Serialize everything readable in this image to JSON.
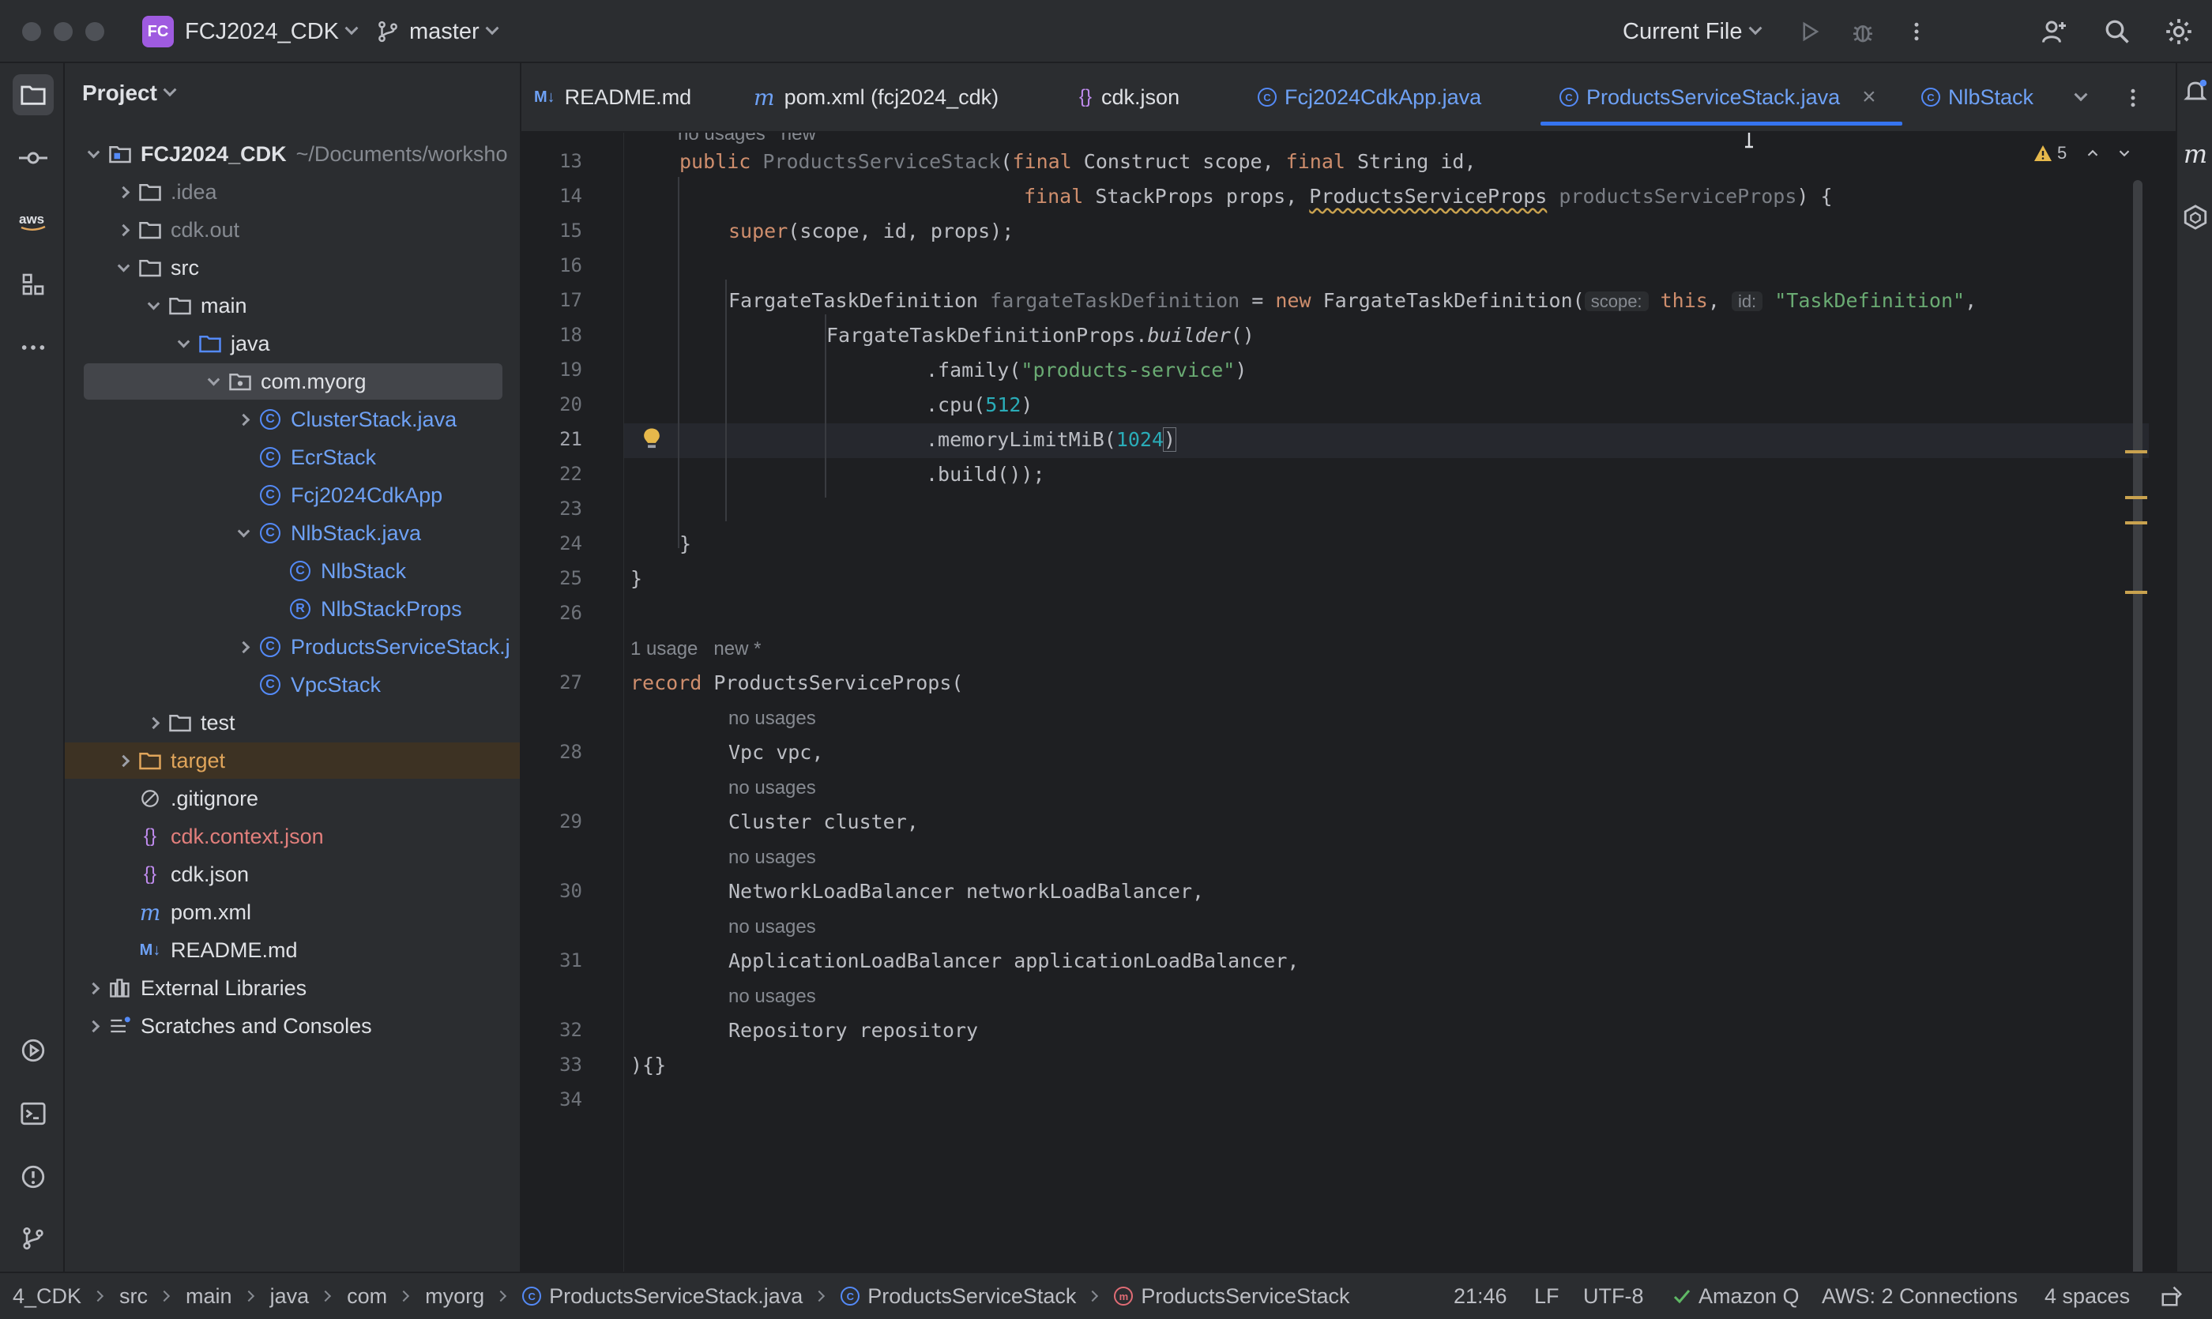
{
  "titlebar": {
    "project_badge": "FC",
    "project_name": "FCJ2024_CDK",
    "branch": "master",
    "run_config": "Current File"
  },
  "project_panel": {
    "title": "Project",
    "root_name": "FCJ2024_CDK",
    "root_path": "~/Documents/worksho",
    "items": [
      {
        "label": ".idea"
      },
      {
        "label": "cdk.out"
      },
      {
        "label": "src"
      },
      {
        "label": "main"
      },
      {
        "label": "java"
      },
      {
        "label": "com.myorg"
      },
      {
        "label": "ClusterStack.java"
      },
      {
        "label": "EcrStack"
      },
      {
        "label": "Fcj2024CdkApp"
      },
      {
        "label": "NlbStack.java"
      },
      {
        "label": "NlbStack"
      },
      {
        "label": "NlbStackProps"
      },
      {
        "label": "ProductsServiceStack.j"
      },
      {
        "label": "VpcStack"
      },
      {
        "label": "test"
      },
      {
        "label": "target"
      },
      {
        "label": ".gitignore"
      },
      {
        "label": "cdk.context.json"
      },
      {
        "label": "cdk.json"
      },
      {
        "label": "pom.xml"
      },
      {
        "label": "README.md"
      },
      {
        "label": "External Libraries"
      },
      {
        "label": "Scratches and Consoles"
      }
    ]
  },
  "tabs": [
    {
      "icon": "M↓",
      "label": "README.md"
    },
    {
      "icon": "m",
      "label": "pom.xml (fcj2024_cdk)"
    },
    {
      "icon": "{}",
      "label": "cdk.json"
    },
    {
      "icon": "C",
      "label": "Fcj2024CdkApp.java"
    },
    {
      "icon": "C",
      "label": "ProductsServiceStack.java"
    },
    {
      "icon": "C",
      "label": "NlbStack"
    }
  ],
  "editor": {
    "warning_count": "5",
    "top_hint": "no usages   new",
    "line_numbers": [
      "13",
      "14",
      "15",
      "16",
      "17",
      "18",
      "19",
      "20",
      "21",
      "22",
      "23",
      "24",
      "25",
      "26",
      "27",
      "28",
      "29",
      "30",
      "31",
      "32",
      "33",
      "34"
    ],
    "hints": {
      "record_usage": "1 usage",
      "record_new": "new *",
      "no_usages": "no usages"
    },
    "inlays": {
      "scope": "scope:",
      "id": "id:"
    },
    "tokens": {
      "public": "public",
      "ctor_name": "ProductsServiceStack",
      "final": "final",
      "construct_scope": "Construct scope, ",
      "string_id": "String id,",
      "stackprops": "StackProps props, ",
      "psp_type": "ProductsServiceProps",
      "psp_param": " productsServiceProps",
      "brace_open": ") {",
      "super_kw": "super",
      "super_args": "(scope, id, props);",
      "ftd_type": "FargateTaskDefinition ",
      "ftd_var": "fargateTaskDefinition",
      "eq": " = ",
      "new_kw": "new",
      "ftd_ctor": " FargateTaskDefinition(",
      "this_kw": "this",
      "comma": ", ",
      "task_def_str": "\"TaskDefinition\"",
      "trail_comma": ",",
      "builder_line": "FargateTaskDefinitionProps.",
      "builder_call": "builder",
      "parens": "()",
      "family_call": ".family(",
      "family_str": "\"products-service\"",
      "close_paren": ")",
      "cpu_call": ".cpu(",
      "cpu_val": "512",
      "mem_call": ".memoryLimitMiB(",
      "mem_val": "1024",
      "build_call": ".build());",
      "close_brace": "}",
      "record_kw": "record",
      "record_name": " ProductsServiceProps(",
      "f_vpc": "Vpc vpc,",
      "f_cluster": "Cluster cluster,",
      "f_nlb": "NetworkLoadBalancer networkLoadBalancer,",
      "f_alb": "ApplicationLoadBalancer applicationLoadBalancer,",
      "f_repo": "Repository repository",
      "record_end": "){}"
    }
  },
  "statusbar": {
    "crumbs": [
      "4_CDK",
      "src",
      "main",
      "java",
      "com",
      "myorg",
      "ProductsServiceStack.java",
      "ProductsServiceStack",
      "ProductsServiceStack"
    ],
    "position": "21:46",
    "line_sep": "LF",
    "encoding": "UTF-8",
    "amazon_q": "Amazon Q",
    "aws": "AWS: 2 Connections",
    "indent": "4 spaces"
  },
  "colors": {
    "accent": "#3574f0",
    "keyword": "#cf8e6d",
    "string": "#6aab73",
    "number": "#2aacb8"
  }
}
